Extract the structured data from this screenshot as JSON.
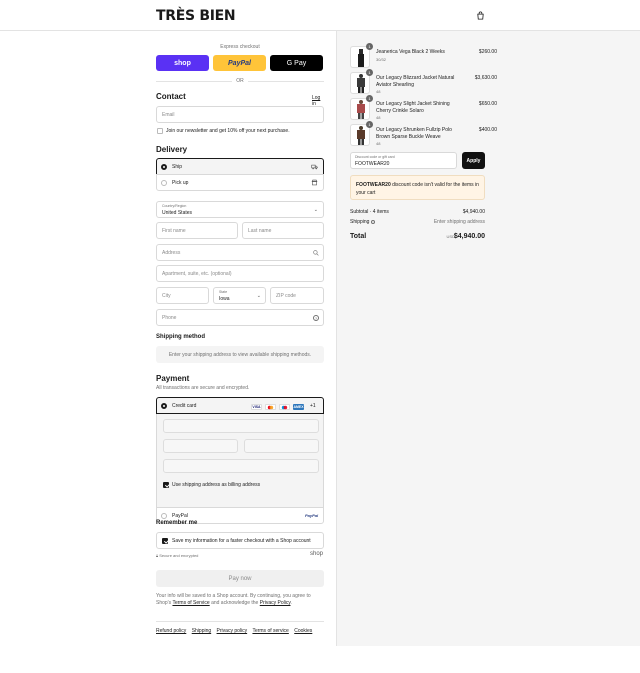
{
  "header": {
    "logo": "TRÈS BIEN",
    "cart_icon": "shopping-bag-icon"
  },
  "express": {
    "title": "Express checkout",
    "shop_label": "shop",
    "paypal_label": "PayPal",
    "gpay_label": "G Pay",
    "or_label": "OR"
  },
  "contact": {
    "title": "Contact",
    "login_label": "Log in",
    "email_placeholder": "Email",
    "newsletter_label": "Join our newsletter and get 10% off your next purchase."
  },
  "delivery": {
    "title": "Delivery",
    "ship_label": "Ship",
    "pickup_label": "Pick up",
    "country_label": "Country/Region",
    "country_value": "United States",
    "first_name_placeholder": "First name",
    "last_name_placeholder": "Last name",
    "address_placeholder": "Address",
    "apartment_placeholder": "Apartment, suite, etc. (optional)",
    "city_placeholder": "City",
    "state_label": "State",
    "state_value": "Iowa",
    "zip_placeholder": "ZIP code",
    "phone_placeholder": "Phone"
  },
  "shipping_method": {
    "title": "Shipping method",
    "notice": "Enter your shipping address to view available shipping methods."
  },
  "payment": {
    "title": "Payment",
    "subtitle": "All transactions are secure and encrypted.",
    "credit_card_label": "Credit card",
    "card_brands": [
      "VISA",
      "MC",
      "MAE",
      "AMEX"
    ],
    "more_brands": "+1",
    "billing_label": "Use shipping address as billing address",
    "paypal_label": "PayPal",
    "paypal_logo": "PayPal"
  },
  "remember": {
    "title": "Remember me",
    "save_label": "Save my information for a faster checkout with a Shop account",
    "secure_label": "Secure and encrypted",
    "shop_logo": "shop"
  },
  "pay_now_label": "Pay now",
  "legal": {
    "text1": "Your info will be saved to a Shop account. By continuing, you agree to Shop's",
    "terms": "Terms of Service",
    "text2": "and acknowledge the",
    "privacy": "Privacy Policy",
    "end": "."
  },
  "footer_links": [
    "Refund policy",
    "Shipping",
    "Privacy policy",
    "Terms of service",
    "Cookies"
  ],
  "cart": {
    "items": [
      {
        "qty": "1",
        "name": "Jeanerica Vega Black 2 Weeks",
        "variant": "30/32",
        "price": "$260.00",
        "color": "#1c1c1c"
      },
      {
        "qty": "1",
        "name": "Our Legacy Blizzard Jacket Natural Aviator Shearling",
        "variant": "48",
        "price": "$3,630.00",
        "color": "#3a3a3a"
      },
      {
        "qty": "1",
        "name": "Our Legacy Slight Jacket Shining Cherry Crinkle Solaro",
        "variant": "48",
        "price": "$650.00",
        "color": "#a84a4a"
      },
      {
        "qty": "1",
        "name": "Our Legacy Shrunken Fullzip Polo Brown Sparse Buckle Weave",
        "variant": "48",
        "price": "$400.00",
        "color": "#5a3a2a"
      }
    ],
    "discount_label": "Discount code or gift card",
    "discount_value": "FOOTWEAR20",
    "apply_label": "Apply",
    "error_code": "FOOTWEAR20",
    "error_text": "discount code isn't valid for the items in your cart",
    "subtotal_label": "Subtotal · 4 items",
    "subtotal_value": "$4,940.00",
    "shipping_label": "Shipping",
    "shipping_value": "Enter shipping address",
    "total_label": "Total",
    "currency": "USD",
    "total_value": "$4,940.00"
  }
}
